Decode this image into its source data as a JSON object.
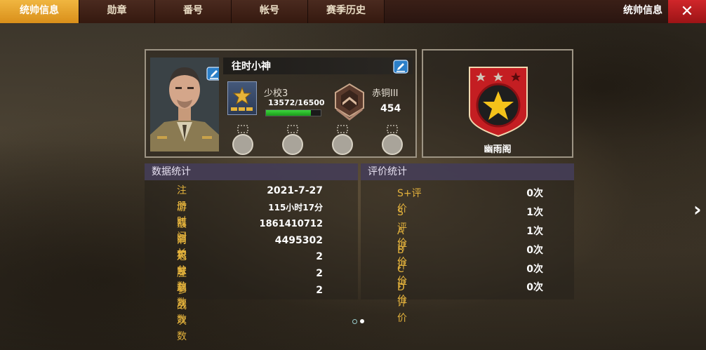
{
  "tabs": [
    {
      "label": "统帅信息",
      "active": true
    },
    {
      "label": "勋章"
    },
    {
      "label": "番号"
    },
    {
      "label": "帐号"
    },
    {
      "label": "赛季历史"
    }
  ],
  "top_title": "统帅信息",
  "close_icon": "close-icon",
  "profile": {
    "name": "往时小神",
    "rank": {
      "name": "少校3",
      "xp": "13572/16500",
      "xp_fraction": 0.823
    },
    "tier": {
      "name": "赤铜III",
      "score": "454"
    }
  },
  "guild": {
    "name": "幽雨阁"
  },
  "data_stats": {
    "title": "数据统计",
    "rows": [
      {
        "label": "注册时间",
        "value": "2021-7-27"
      },
      {
        "label": "游戏时长",
        "value": "115小时17分"
      },
      {
        "label": "最高积分",
        "value": "1861410712"
      },
      {
        "label": "消灭总数",
        "value": "4495302"
      },
      {
        "label": "冠军总数",
        "value": "2"
      },
      {
        "label": "胜利次数",
        "value": "2"
      },
      {
        "label": "参战次数",
        "value": "2"
      }
    ]
  },
  "rating_stats": {
    "title": "评价统计",
    "rows": [
      {
        "label": "S+评价",
        "value": "0次"
      },
      {
        "label": "S评价",
        "value": "1次"
      },
      {
        "label": "A评价",
        "value": "1次"
      },
      {
        "label": "B评价",
        "value": "0次"
      },
      {
        "label": "C评价",
        "value": "0次"
      },
      {
        "label": "D评价",
        "value": "0次"
      }
    ]
  },
  "pager": {
    "pages": 2,
    "current": 2
  },
  "colors": {
    "accent": "#e2b13c",
    "tab_active": "#e8a22c",
    "close": "#c41e22",
    "xp": "#2cc12c"
  }
}
